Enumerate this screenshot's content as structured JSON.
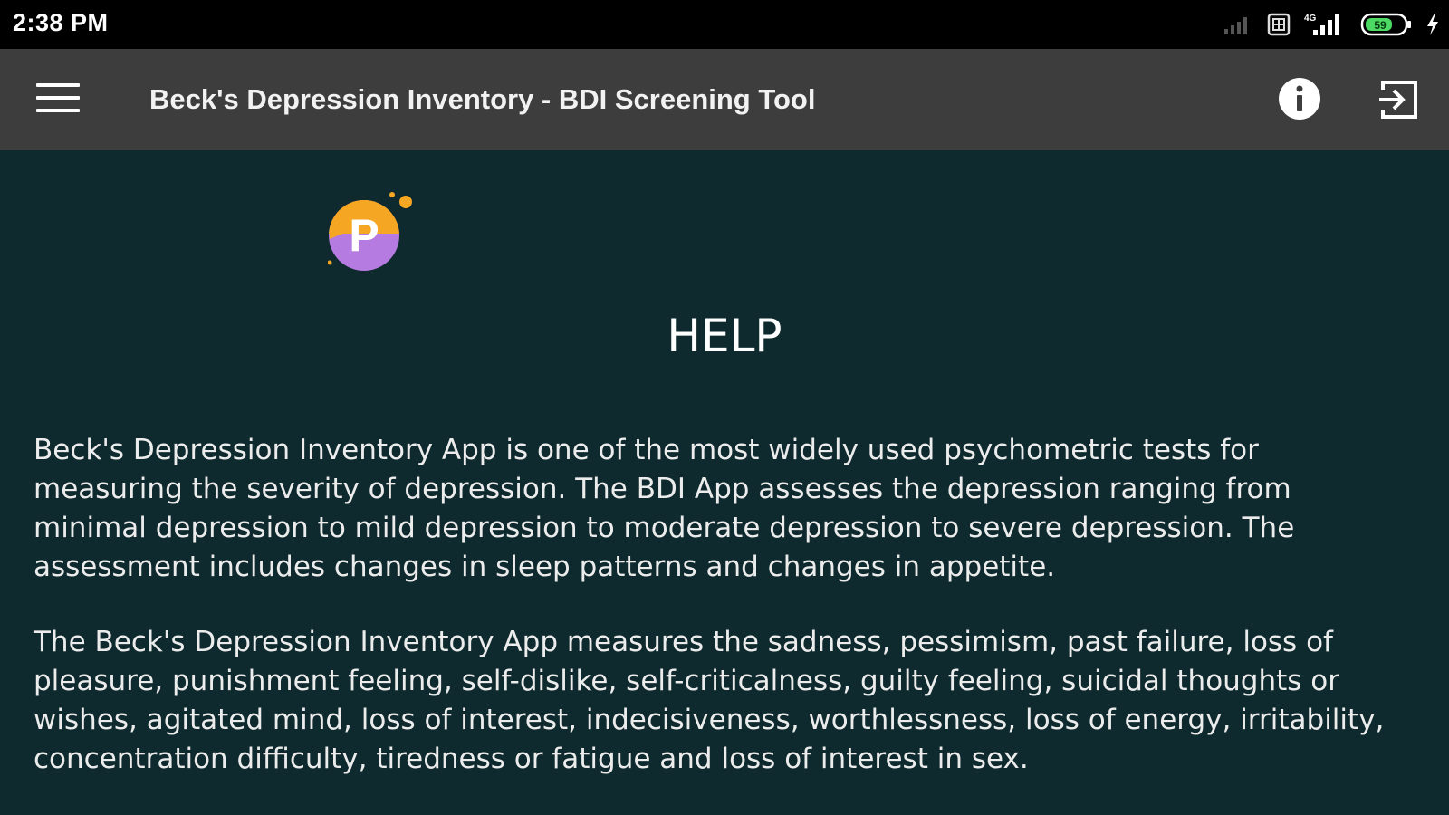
{
  "status_bar": {
    "time": "2:38 PM",
    "battery_level": "59",
    "network_type": "4G",
    "icons": [
      "signal-weak-icon",
      "sim-icon",
      "signal-4g-icon",
      "battery-icon",
      "charging-icon"
    ]
  },
  "app_bar": {
    "title": "Beck's Depression Inventory - BDI Screening Tool",
    "icons": [
      "hamburger-menu-icon",
      "info-icon",
      "exit-icon"
    ]
  },
  "content": {
    "logo_letter": "P",
    "heading": "HELP",
    "paragraph_1": "Beck's Depression Inventory App is one of the most widely used psychometric tests for measuring the severity of depression. The BDI App assesses the depression ranging from minimal depression to mild depression to moderate depression to severe depression. The assessment includes changes in sleep patterns and changes in appetite.",
    "paragraph_2": "The Beck's Depression Inventory App measures the sadness, pessimism, past failure, loss of pleasure, punishment feeling, self-dislike, self-criticalness, guilty feeling, suicidal thoughts or wishes, agitated mind, loss of interest, indecisiveness, worthlessness, loss of energy, irritability, concentration difficulty, tiredness or fatigue and loss of interest in sex."
  },
  "colors": {
    "status_bar": "#000000",
    "app_bar": "#3d3d3d",
    "background": "#0e2a2e",
    "logo_orange": "#f5a623",
    "logo_purple": "#b57be0",
    "battery_green": "#4cd964"
  }
}
